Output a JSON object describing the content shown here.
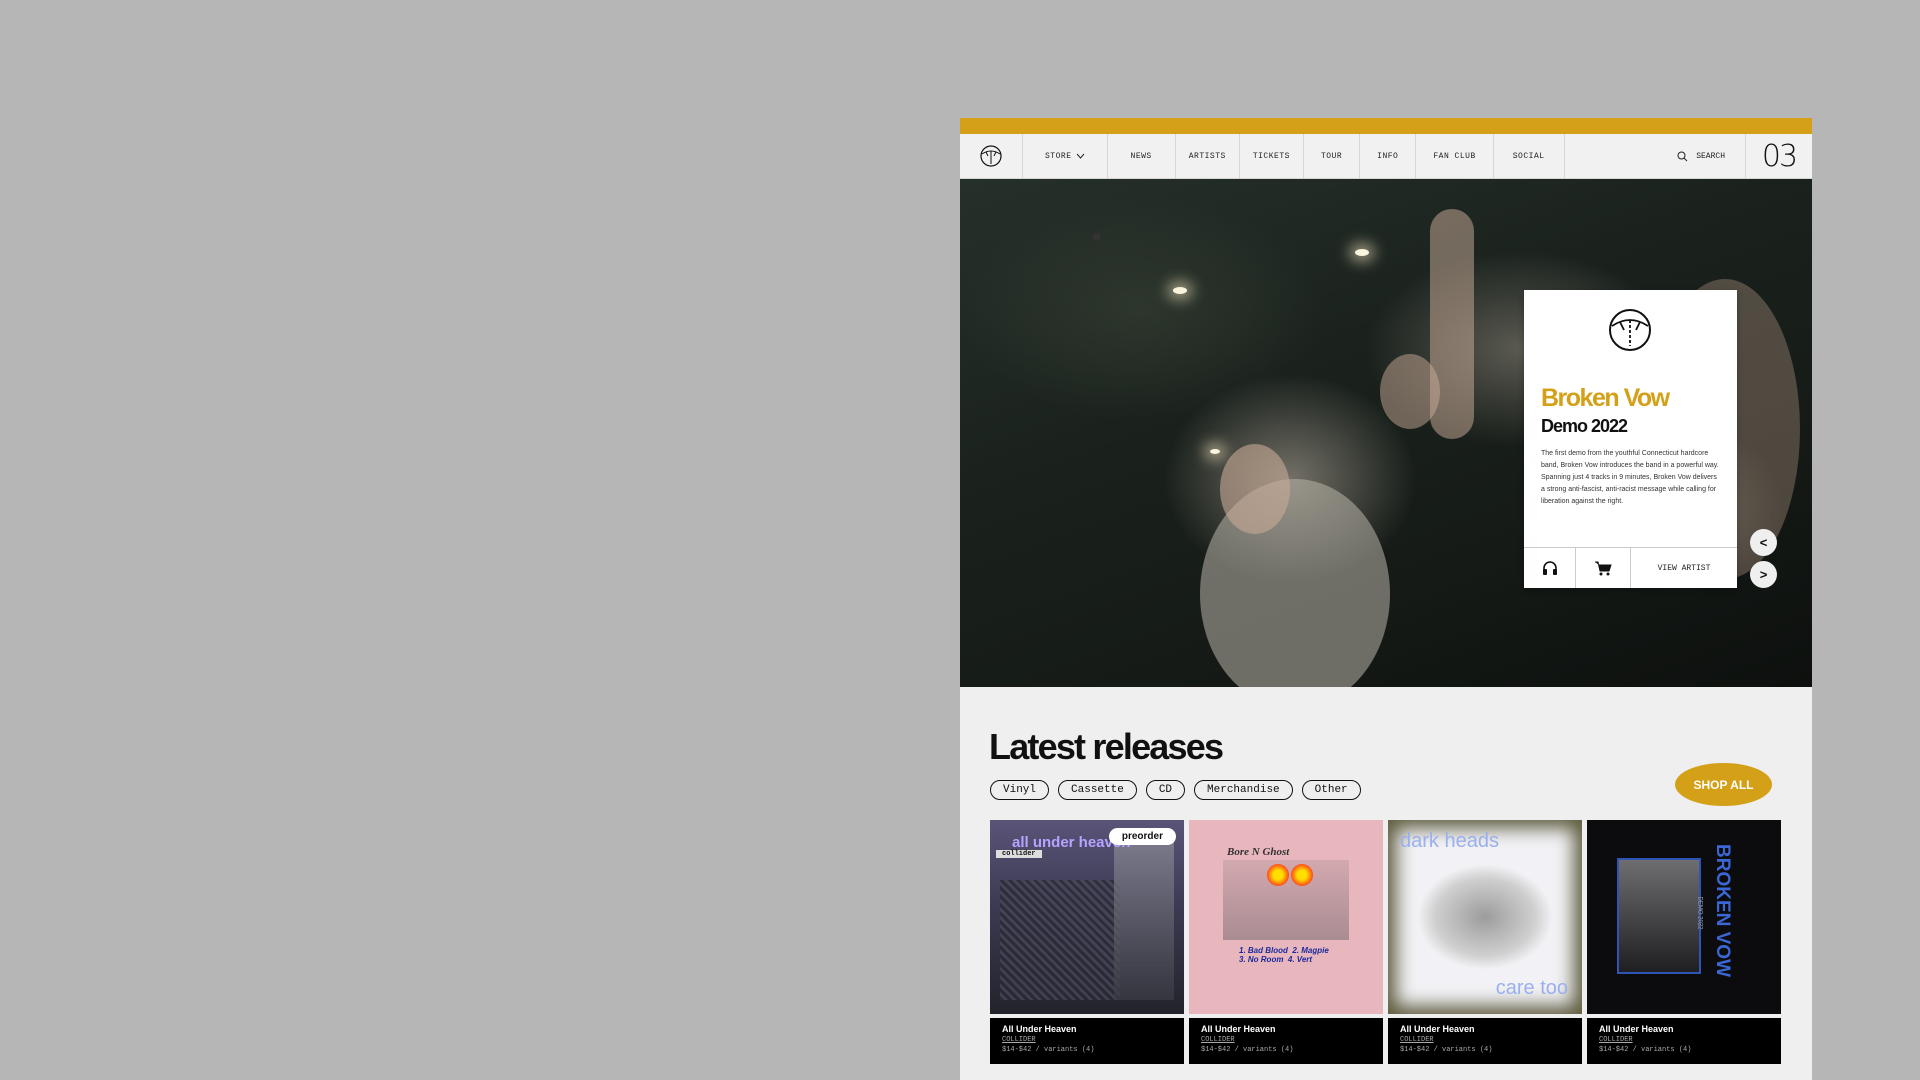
{
  "nav": {
    "items": [
      "STORE",
      "NEWS",
      "ARTISTS",
      "TICKETS",
      "TOUR",
      "INFO",
      "FAN CLUB",
      "SOCIAL"
    ],
    "search_label": "SEARCH",
    "page_number": "03"
  },
  "hero": {
    "artist": "Broken Vow",
    "album": "Demo 2022",
    "description": "The first demo from the youthful Connecticut hardcore band, Broken Vow introduces the band in a powerful way. Spanning just 4 tracks in 9 minutes, Broken Vow delivers a strong anti-fascist, anti-racist message while calling for liberation against the right.",
    "view_artist": "VIEW ARTIST",
    "prev": "<",
    "next": ">"
  },
  "releases": {
    "title": "Latest releases",
    "filters": [
      "Vinyl",
      "Cassette",
      "CD",
      "Merchandise",
      "Other"
    ],
    "shop_all": "SHOP ALL",
    "products": [
      {
        "title": "All Under Heaven",
        "subtitle": "COLLIDER",
        "price": "$14-$42 / variants (4)",
        "badge": "preorder",
        "cover_text": "all under heaven",
        "cover_sub": "collider"
      },
      {
        "title": "All Under Heaven",
        "subtitle": "COLLIDER",
        "price": "$14-$42 / variants (4)",
        "cover_text": "Bore N Ghost",
        "tracks": "1. Bad Blood  2. Magpie\n3. No Room  4. Vert"
      },
      {
        "title": "All Under Heaven",
        "subtitle": "COLLIDER",
        "price": "$14-$42 / variants (4)",
        "cover_text": "dark heads",
        "cover_sub": "care too"
      },
      {
        "title": "All Under Heaven",
        "subtitle": "COLLIDER",
        "price": "$14-$42 / variants (4)",
        "cover_text": "BROKEN VOW",
        "cover_sub": "DEMO 2022"
      }
    ]
  },
  "colors": {
    "accent": "#d4a017",
    "background": "#b6b6b6"
  }
}
